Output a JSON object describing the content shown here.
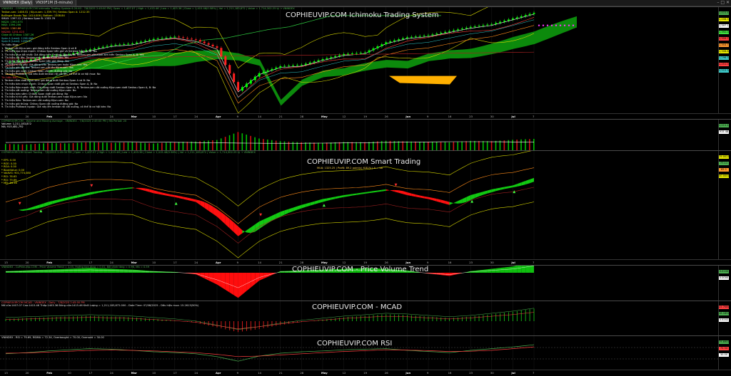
{
  "app": {
    "tabs": [
      {
        "label": "VNINDEX (Daily)",
        "active": true
      },
      {
        "label": "VN30F1M (5-minute)",
        "active": false
      }
    ]
  },
  "xaxis": {
    "labels": [
      "13",
      "20",
      "Feb",
      "10",
      "17",
      "24",
      "Mar",
      "10",
      "17",
      "24",
      "Apr",
      "9",
      "14",
      "21",
      "28",
      "May",
      "12",
      "19",
      "26",
      "Jun",
      "9",
      "16",
      "23",
      "30",
      "Jul",
      "7"
    ],
    "bold": [
      "Feb",
      "Mar",
      "Apr",
      "May",
      "Jun",
      "Jul"
    ]
  },
  "price_pane": {
    "header": "VNINDEX - COPHIEUVIP.COM Ichimoku Trading System 6.20.63 - 7/8/2025 2:45:00 PM | Open = 1,407.07 | High = 1,415.46 | Low = 1,403.36 | Close = 1,415.46(0.58%) | Vol = 1,211,183,872 | Value = 1,714,302.25 tỷ → VNINDEX",
    "watermark": "COPHIEUVIP.COM Ichimoku Trading System",
    "legend_lines": [
      {
        "c": "y",
        "t": "Tenkan-sen: 1408.51 | Kijun-sen: 1,359.79 | Senkou Span A: 1212.35"
      },
      {
        "c": "y",
        "t": "Bollinger Bands Top: 1414.006 | Bottom: 1308.84"
      },
      {
        "c": "w",
        "t": "SMA5: 1397.12 | Senkou Span B: 1353.76"
      },
      {
        "c": "g",
        "t": "MA20: 1392.073"
      },
      {
        "c": "g",
        "t": "MA5: 1394.206"
      },
      {
        "c": "o",
        "t": "MA50: 1380.86"
      },
      {
        "c": "r",
        "t": "MA200: 1251.023"
      },
      {
        "c": "g",
        "t": "Close At Chikou: 1347.26"
      },
      {
        "c": "c",
        "t": "Span A (Lead): 1156.066"
      },
      {
        "c": "c",
        "t": "Span B (Lead): 1296.31"
      },
      {
        "c": "w",
        "t": "Tín hiệu Mua:"
      },
      {
        "c": "w",
        "t": "1. Tenkan cắt Kijun-sen: giá đóng trên Senkou Span A và B"
      },
      {
        "c": "w",
        "t": "2. Tín hiệu tạo nhạn mạnh: Chikou Span trên giá và Senkou Span A, B: Yes"
      },
      {
        "c": "w",
        "t": "3. Tín hiệu Mua tốt nhất: Giá đóng trên Senkou Span A, B; Tenkan-sen cắt Kijun-sen trên Senkou Span A, B: Yes"
      },
      {
        "c": "w",
        "t": "4. Tín hiệu cắt lên: Tenkan-sen cắt lên Kijun-sen: Yes"
      },
      {
        "c": "w",
        "t": "5. Tín hiệu Mua sớm: Chikou Span trên giá đóng: Yes"
      },
      {
        "c": "w",
        "t": "6. Tín hiệu từ từ yếu: Giá đóng trên Tenkan-sen hoặc Kijun-sen: Yes"
      },
      {
        "c": "w",
        "t": "7. Tín hiệu giá cắt lên: Tenkan-sen cắt lên Kijun-sen: Yes"
      },
      {
        "c": "w",
        "t": "8. Tín hiệu giá vượt: Chikou Span cắt lên đường giá: No"
      },
      {
        "c": "w",
        "t": "9. Tín hiệu Pullback: Giá kéo dưới tenkan rồi cắt lên, có thể là cơ hội mua: No"
      },
      {
        "c": "r",
        "t": "Tín hiệu Bán:"
      },
      {
        "c": "w",
        "t": "1. Tenkan nằm dưới Kijun-sen: giá đóng dưới Senkou Span A và B: No"
      },
      {
        "c": "w",
        "t": "2. Tín hiệu bán nhạn mạnh: Chikou Span dưới giá và Senkou Span A, B: No"
      },
      {
        "c": "w",
        "t": "3. Tín hiệu Bán mạnh nhất: Giá đóng dưới Senkou Span A, B; Tenkan-sen cắt xuống Kijun-sen dưới Senkou Span A, B: No"
      },
      {
        "c": "w",
        "t": "4. Tín hiệu cắt xuống: Tenkan-sen cắt xuống Kijun-sen: No"
      },
      {
        "c": "w",
        "t": "5. Tín hiệu bán sớm: Chikou Span dưới giá đóng: No"
      },
      {
        "c": "w",
        "t": "6. Tín hiệu từ từ yếu: Giá đóng dưới Tenkan-sen hoặc Kijun-sen: No"
      },
      {
        "c": "w",
        "t": "7. Tín hiệu Bán: Tenkan-sen cắt xuống Kijun-sen: No"
      },
      {
        "c": "w",
        "t": "8. Tín hiệu giá thủng: Chikou Span cắt xuống đường giá: No"
      },
      {
        "c": "w",
        "t": "9. Tín hiệu Pullback ngược: Giá nảy lên tenkan rồi cắt xuống, có thể là cơ hội bán: No"
      }
    ],
    "price_tags": [
      {
        "v": "1,415.46",
        "color": "#4caf50"
      },
      {
        "v": "1,408.51",
        "color": "#e8e800"
      },
      {
        "v": "1,397.12",
        "color": "#ffffff"
      },
      {
        "v": "1,392.07",
        "color": "#40e040"
      },
      {
        "v": "1,359.79",
        "color": "#ff4040"
      },
      {
        "v": "1,353.76",
        "color": "#ff9a30"
      },
      {
        "v": "1,308.84",
        "color": "#e8e800"
      },
      {
        "v": "1,296.31",
        "color": "#40d0d0"
      },
      {
        "v": "1,251.02",
        "color": "#ff4040"
      },
      {
        "v": "1,212.35",
        "color": "#40d0d0"
      }
    ]
  },
  "volume_pane": {
    "header": "COPHIEUVIP.COM - Volume and Moving Average - VNINDEX - 7/8/2025 2:45:00 PM | MA Period: 20",
    "sub1": "Volume: 1,211,183,872",
    "sub2": "MA: 915,481,792",
    "tags": [
      {
        "v": "1,211.18",
        "color": "#4caf50"
      },
      {
        "v": "915.48",
        "color": "#ffffff"
      }
    ]
  },
  "smart_pane": {
    "header": "COPHIEUVIP.COM Smart Trading - 7/8/2025 2:45:00 PM | Open = 1,407.07 | High = 1,415.46 | Low = 1,403.36 | Close = 1,415.46(0.58%) | Vol = 1,211,183,872 | Value = 1,714,302.25 tỷ → VNINDEX",
    "watermark": "COPHIEUVIP.COM Smart Trading",
    "sub": "MUA: 1325.25 | Profit: 89.2 point(s) 6.81% | A = 18",
    "legend_lines": [
      {
        "c": "y",
        "t": "* EPS:       0.00"
      },
      {
        "c": "y",
        "t": "* ROE:       0.00"
      },
      {
        "c": "y",
        "t": "* ROA:       0.00"
      },
      {
        "c": "y",
        "t": "* BookValue:   0.00"
      },
      {
        "c": "y",
        "t": "* VolAVG: 901,774,080"
      },
      {
        "c": "y",
        "t": "* RSI:       78.63"
      },
      {
        "c": "y",
        "t": "* RSI:       79.69"
      },
      {
        "c": "y",
        "t": "* MFI:       84.18"
      }
    ],
    "tags": [
      {
        "v": "79.0025",
        "color": "#e8e800"
      },
      {
        "v": "77.11",
        "color": "#4caf50"
      },
      {
        "v": "65.1",
        "color": "#ff9a30"
      },
      {
        "v": "50.0000",
        "color": "#e8e800"
      }
    ]
  },
  "pvt_pane": {
    "header": "VNINDEX - CoPhieuVip.COM - Price Volume Trend = 1.45, Hướng tích tăng = 0.01, Bối cảnh tăng = 0.96, MA = 0.59",
    "watermark": "COPHIEUVIP.COM - Price Volume Trend",
    "tags": [
      {
        "v": "0.0100",
        "color": "#4caf50"
      },
      {
        "v": "0.0000",
        "color": "#ffffff"
      }
    ]
  },
  "macd_pane": {
    "header": "COPHIEUVIP.COM MCAD - VNINDEX - Daily - 7/8/2025 2:45:00 PM",
    "sub": "Mở cửa:1407.07  Cao:1415.46  Thấp:1403.36  Đóng cửa:1415.46  Khối Lượng = 1,211,183,872.000 - Date Time: 07/08/2025 - Dấu hiệu mua: 15.2613(50%)",
    "watermark": "COPHIEUVIP.COM - MCAD",
    "tags": [
      {
        "v": "22.7080",
        "color": "#ff4040"
      },
      {
        "v": "16.1850",
        "color": "#4caf50"
      },
      {
        "v": "5.5202",
        "color": "#ffffff"
      }
    ]
  },
  "rsi_pane": {
    "header": "VNINDEX - RSI = 79.69, RSIMA = 72.34, Overbought = 70.00, Oversold = 30.00",
    "watermark": "COPHIEUVIP.COM RSI",
    "tags": [
      {
        "v": "79.6900",
        "color": "#4caf50"
      },
      {
        "v": "72.34",
        "color": "#ff4040"
      },
      {
        "v": "30.00",
        "color": "#ffffff"
      }
    ]
  },
  "chart_data": [
    {
      "type": "line",
      "title": "COPHIEUVIP.COM Ichimoku Trading System",
      "x": [
        "13",
        "20",
        "Feb",
        "10",
        "17",
        "24",
        "Mar",
        "10",
        "17",
        "24",
        "Apr",
        "9",
        "14",
        "21",
        "28",
        "May",
        "12",
        "19",
        "26",
        "Jun",
        "9",
        "16",
        "23",
        "30",
        "Jul",
        "7"
      ],
      "series": [
        {
          "name": "Close",
          "values": [
            1240,
            1245,
            1262,
            1268,
            1285,
            1300,
            1306,
            1322,
            1330,
            1318,
            1290,
            1138,
            1200,
            1225,
            1230,
            1250,
            1268,
            1274,
            1310,
            1328,
            1335,
            1350,
            1365,
            1375,
            1395,
            1415
          ]
        }
      ],
      "ylim": [
        1070,
        1420
      ]
    },
    {
      "type": "bar",
      "title": "Volume and Moving Average",
      "values": [
        700,
        650,
        800,
        760,
        900,
        820,
        880,
        750,
        900,
        950,
        1100,
        1900,
        1250,
        980,
        870,
        820,
        900,
        880,
        1020,
        960,
        910,
        870,
        1010,
        980,
        1120,
        1211
      ]
    },
    {
      "type": "area",
      "title": "COPHIEUVIP.COM Smart Trading",
      "series": [
        {
          "name": "RSI",
          "values": [
            45,
            48,
            55,
            60,
            65,
            68,
            70,
            64,
            60,
            55,
            40,
            20,
            35,
            45,
            52,
            58,
            62,
            65,
            68,
            62,
            58,
            52,
            62,
            68,
            72,
            79.69
          ]
        }
      ],
      "ylim": [
        0,
        100
      ]
    },
    {
      "type": "area",
      "title": "COPHIEUVIP.COM - Price Volume Trend",
      "values": [
        0.2,
        0.3,
        0.4,
        0.5,
        0.6,
        0.5,
        0.4,
        0.2,
        0.1,
        -0.2,
        -1.5,
        -3.2,
        -1.0,
        0.2,
        0.3,
        0.4,
        0.5,
        0.6,
        0.5,
        0.3,
        -0.1,
        -0.4,
        0.2,
        0.5,
        0.8,
        1.45
      ]
    },
    {
      "type": "bar",
      "title": "COPHIEUVIP.COM - MCAD",
      "values": [
        3,
        4,
        5,
        6,
        7,
        6,
        5,
        3,
        1,
        -2,
        -8,
        -14,
        -10,
        -5,
        -1,
        2,
        5,
        7,
        9,
        8,
        6,
        4,
        6,
        9,
        12,
        16.18
      ]
    },
    {
      "type": "line",
      "title": "COPHIEUVIP.COM RSI",
      "series": [
        {
          "name": "RSI",
          "values": [
            48,
            52,
            58,
            62,
            66,
            64,
            60,
            55,
            52,
            48,
            38,
            22,
            40,
            50,
            55,
            58,
            62,
            64,
            66,
            60,
            56,
            52,
            60,
            66,
            72,
            79.69
          ]
        },
        {
          "name": "RSIMA",
          "values": [
            50,
            51,
            54,
            57,
            60,
            61,
            60,
            58,
            55,
            52,
            46,
            38,
            40,
            44,
            48,
            52,
            56,
            59,
            62,
            61,
            59,
            56,
            57,
            60,
            66,
            72.34
          ]
        }
      ],
      "ylim": [
        0,
        100
      ]
    }
  ]
}
